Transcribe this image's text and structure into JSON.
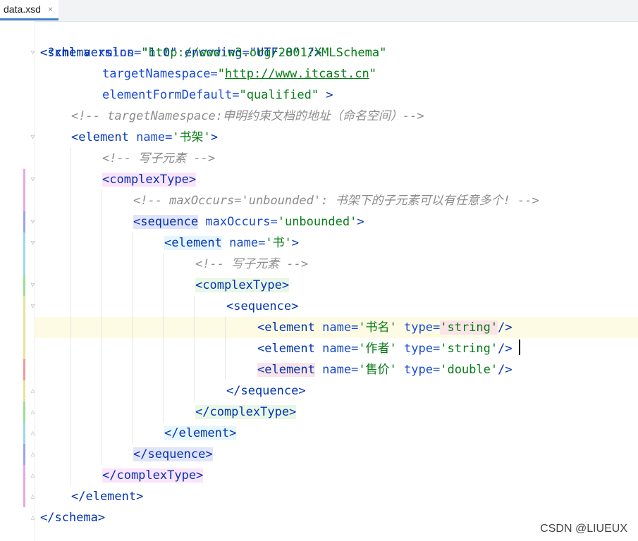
{
  "tab": {
    "file_name": "data.xsd",
    "close_glyph": "×"
  },
  "watermark": "CSDN @LIUEUX",
  "code": {
    "l1": {
      "decl": "<?xml version=\"1.0\" encoding=\"UTF-8\" ?>"
    },
    "l2": {
      "open": "<schema",
      "attr": " xmlns=",
      "val": "\"http://www.w3.org/2001/XMLSchema\""
    },
    "l3": {
      "attr": "targetNamespace=",
      "q1": "\"",
      "url": "http://www.itcast.cn",
      "q2": "\""
    },
    "l4": {
      "attr": "elementFormDefault=",
      "val": "\"qualified\"",
      "end": " >"
    },
    "l5": {
      "comment": "<!-- targetNamespace:申明约束文档的地址（命名空间）-->"
    },
    "l6": {
      "open": "<element",
      "attr": " name=",
      "val": "'书架'",
      "end": ">"
    },
    "l7": {
      "comment": "<!-- 写子元素 -->"
    },
    "l8": {
      "tag": "<complexType>"
    },
    "l9": {
      "comment": "<!-- maxOccurs='unbounded': 书架下的子元素可以有任意多个! -->"
    },
    "l10": {
      "open": "<sequence",
      "attr": " maxOccurs=",
      "val": "'unbounded'",
      "end": ">"
    },
    "l11": {
      "open": "<element",
      "attr": " name=",
      "val": "'书'",
      "end": ">"
    },
    "l12": {
      "comment": "<!-- 写子元素 -->"
    },
    "l13": {
      "tag": "<complexType>"
    },
    "l14": {
      "tag": "<sequence>"
    },
    "l15": {
      "open": "<element",
      "attr1": " name=",
      "val1": "'书名'",
      "attr2": " type=",
      "val2a": "'st",
      "val2b": "ring'",
      "end": "/>"
    },
    "l16": {
      "open": "<element",
      "attr1": " name=",
      "val1": "'作者'",
      "attr2": " type=",
      "val2": "'string'",
      "end": "/>"
    },
    "l17": {
      "open": "<element",
      "attr1": " name=",
      "val1": "'售价'",
      "attr2": " type=",
      "val2": "'double'",
      "end": "/>"
    },
    "l18": {
      "tag": "</sequence>"
    },
    "l19": {
      "tag": "</complexType>"
    },
    "l20": {
      "tag": "</element>"
    },
    "l21": {
      "tag": "</sequence>"
    },
    "l22": {
      "tag": "</complexType>"
    },
    "l23": {
      "tag": "</element>"
    },
    "l24": {
      "tag": "</schema>"
    }
  },
  "colors": {
    "tag": "#0033b3",
    "attr": "#174ad4",
    "value": "#067d17",
    "comment": "#8c8c8c",
    "bracket_pink": "#fbe3f9",
    "bracket_lavender": "#e2e4f8",
    "bracket_cyan": "#e6f6fd",
    "bracket_green": "#e9f7e6",
    "bracket_red": "#fbe4e7",
    "current_line": "#fdfbe4"
  },
  "icons": {
    "fold_open": "fold-open-icon",
    "fold_close": "fold-close-icon",
    "tab_close": "close-icon"
  }
}
